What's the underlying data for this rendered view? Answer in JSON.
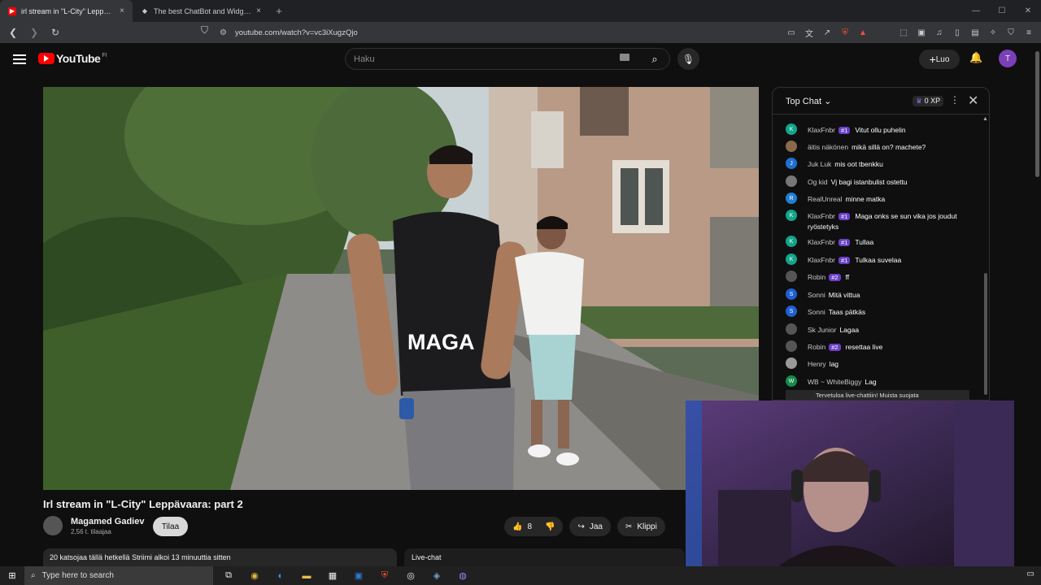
{
  "browser": {
    "tabs": [
      {
        "title": "irl stream in \"L-City\" Leppävaara:",
        "active": true
      },
      {
        "title": "The best ChatBot and Widgets for K",
        "active": false
      }
    ],
    "url": "youtube.com/watch?v=vc3iXugzQjo",
    "close_glyph": "×",
    "newtab_glyph": "+"
  },
  "youtube": {
    "logo_text": "YouTube",
    "country_code": "FI",
    "search_placeholder": "Haku",
    "create_label": "Luo",
    "avatar_letter": "T"
  },
  "video": {
    "title": "Irl stream in \"L-City\" Leppävaara: part 2",
    "shirt_text": "MAGA"
  },
  "channel": {
    "name": "Magamed Gadiev",
    "subscribers": "2,56 t. tilaajaa",
    "subscribe_label": "Tilaa"
  },
  "actions": {
    "like_count": "8",
    "share_label": "Jaa",
    "clip_label": "Klippi"
  },
  "description": {
    "summary": "20 katsojaa tällä hetkellä Striimi alkoi 13 minuuttia sitten"
  },
  "livechat_bar": {
    "label": "Live-chat"
  },
  "chat": {
    "header": "Top Chat",
    "xp": "0 XP",
    "messages": [
      {
        "avatar": "K",
        "color": "#12a58a",
        "author": "KlaxFnbr",
        "badge": "#1",
        "text": "Vitut ollu puhelin"
      },
      {
        "avatar": "",
        "color": "#8a6a4a",
        "author": "äitis näkönen",
        "badge": "",
        "text": "mikä sillä on? machete?"
      },
      {
        "avatar": "J",
        "color": "#1f6fd1",
        "author": "Juk Luk",
        "badge": "",
        "text": "mis oot tbenkku"
      },
      {
        "avatar": "",
        "color": "#777777",
        "author": "Og kid",
        "badge": "",
        "text": "Vj bagi istanbulist ostettu"
      },
      {
        "avatar": "R",
        "color": "#1f7fd1",
        "author": "RealUnreal",
        "badge": "",
        "text": "minne matka"
      },
      {
        "avatar": "K",
        "color": "#12a58a",
        "author": "KlaxFnbr",
        "badge": "#1",
        "text": "Maga onks se sun vika jos joudut ryöstetyks"
      },
      {
        "avatar": "K",
        "color": "#12a58a",
        "author": "KlaxFnbr",
        "badge": "#1",
        "text": "Tullaa"
      },
      {
        "avatar": "K",
        "color": "#12a58a",
        "author": "KlaxFnbr",
        "badge": "#1",
        "text": "Tulkaa suvelaa"
      },
      {
        "avatar": "",
        "color": "#555555",
        "author": "Robin",
        "badge": "#2",
        "text": "ff"
      },
      {
        "avatar": "S",
        "color": "#1f5fd1",
        "author": "Sonni",
        "badge": "",
        "text": "Mitä vittua"
      },
      {
        "avatar": "S",
        "color": "#1f5fd1",
        "author": "Sonni",
        "badge": "",
        "text": "Taas pätkäs"
      },
      {
        "avatar": "",
        "color": "#555555",
        "author": "Sk Junior",
        "badge": "",
        "text": "Lagaa"
      },
      {
        "avatar": "",
        "color": "#555555",
        "author": "Robin",
        "badge": "#2",
        "text": "resettaa live"
      },
      {
        "avatar": "",
        "color": "#999999",
        "author": "Henry",
        "badge": "",
        "text": "lag"
      },
      {
        "avatar": "W",
        "color": "#178a4a",
        "author": "WB ~ WhiteBiggy",
        "badge": "",
        "text": "Lag"
      }
    ],
    "banner": "Tervetuloa live-chattiin! Muista suojata"
  },
  "taskbar": {
    "search_placeholder": "Type here to search"
  },
  "colors": {
    "accent": "#ff0000",
    "badge": "#6a3fc8",
    "avatar": "#7b3fb8"
  }
}
